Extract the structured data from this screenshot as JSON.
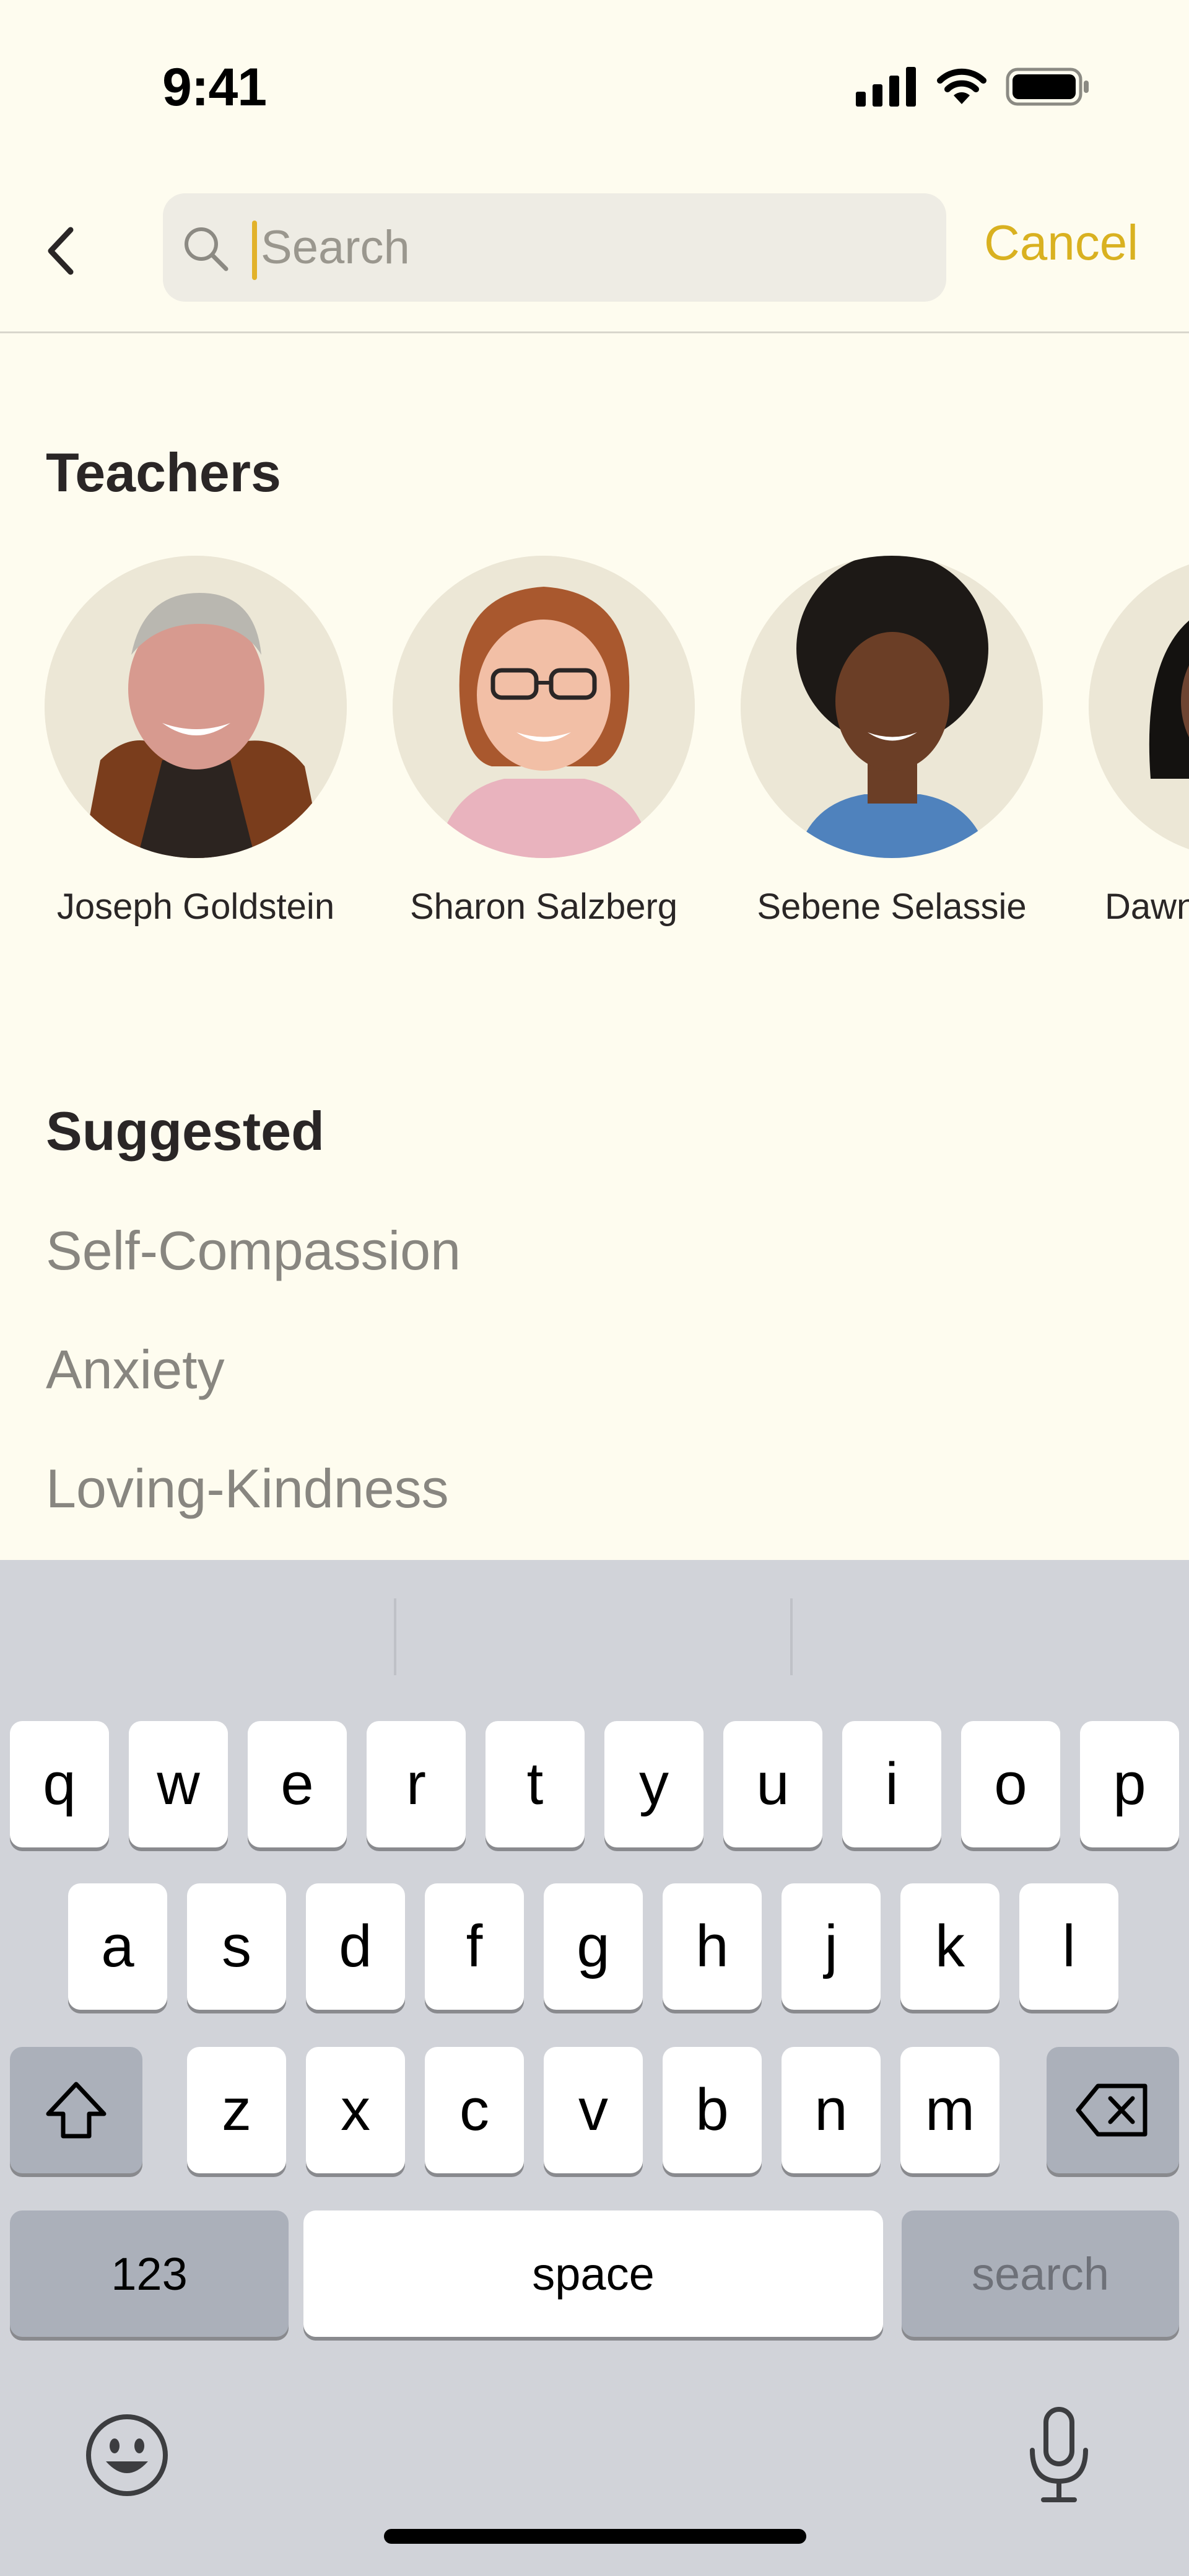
{
  "status": {
    "time": "9:41"
  },
  "search": {
    "placeholder": "Search",
    "value": "",
    "cancel_label": "Cancel"
  },
  "teachers": {
    "title": "Teachers",
    "items": [
      {
        "name": "Joseph Goldstein"
      },
      {
        "name": "Sharon Salzberg"
      },
      {
        "name": "Sebene Selassie"
      },
      {
        "name": "Dawn"
      }
    ]
  },
  "suggested": {
    "title": "Suggested",
    "items": [
      "Self-Compassion",
      "Anxiety",
      "Loving-Kindness"
    ]
  },
  "keyboard": {
    "row1": [
      "q",
      "w",
      "e",
      "r",
      "t",
      "y",
      "u",
      "i",
      "o",
      "p"
    ],
    "row2": [
      "a",
      "s",
      "d",
      "f",
      "g",
      "h",
      "j",
      "k",
      "l"
    ],
    "row3": [
      "z",
      "x",
      "c",
      "v",
      "b",
      "n",
      "m"
    ],
    "numbers_label": "123",
    "space_label": "space",
    "return_label": "search"
  },
  "colors": {
    "accent": "#d9b120",
    "background": "#fefcef",
    "keyboard": "#d1d3d9"
  }
}
